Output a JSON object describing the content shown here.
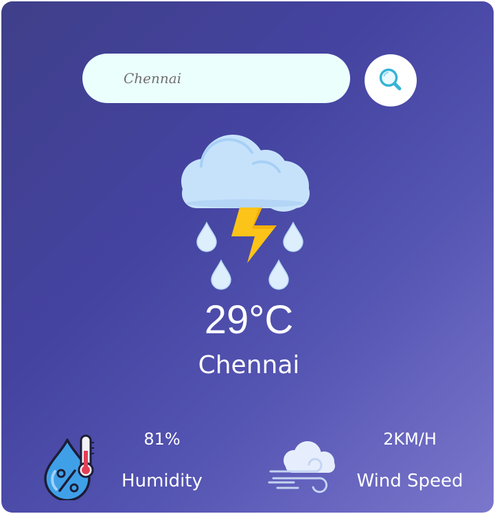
{
  "search": {
    "value": "",
    "placeholder": "Chennai",
    "button_icon": "search-icon"
  },
  "weather": {
    "icon": "thunderstorm-rain-icon",
    "temperature": "29°C",
    "city": "Chennai"
  },
  "details": {
    "humidity": {
      "icon": "humidity-thermometer-icon",
      "value": "81%",
      "label": "Humidity"
    },
    "wind": {
      "icon": "wind-cloud-icon",
      "value": "2KM/H",
      "label": "Wind Speed"
    }
  },
  "colors": {
    "gradient_start": "#3f3f8a",
    "gradient_end": "#7b77cc",
    "input_bg": "#ebfffc",
    "search_icon": "#3bb5d8",
    "cloud": "#c6e2fb",
    "lightning": "#fcc419"
  }
}
